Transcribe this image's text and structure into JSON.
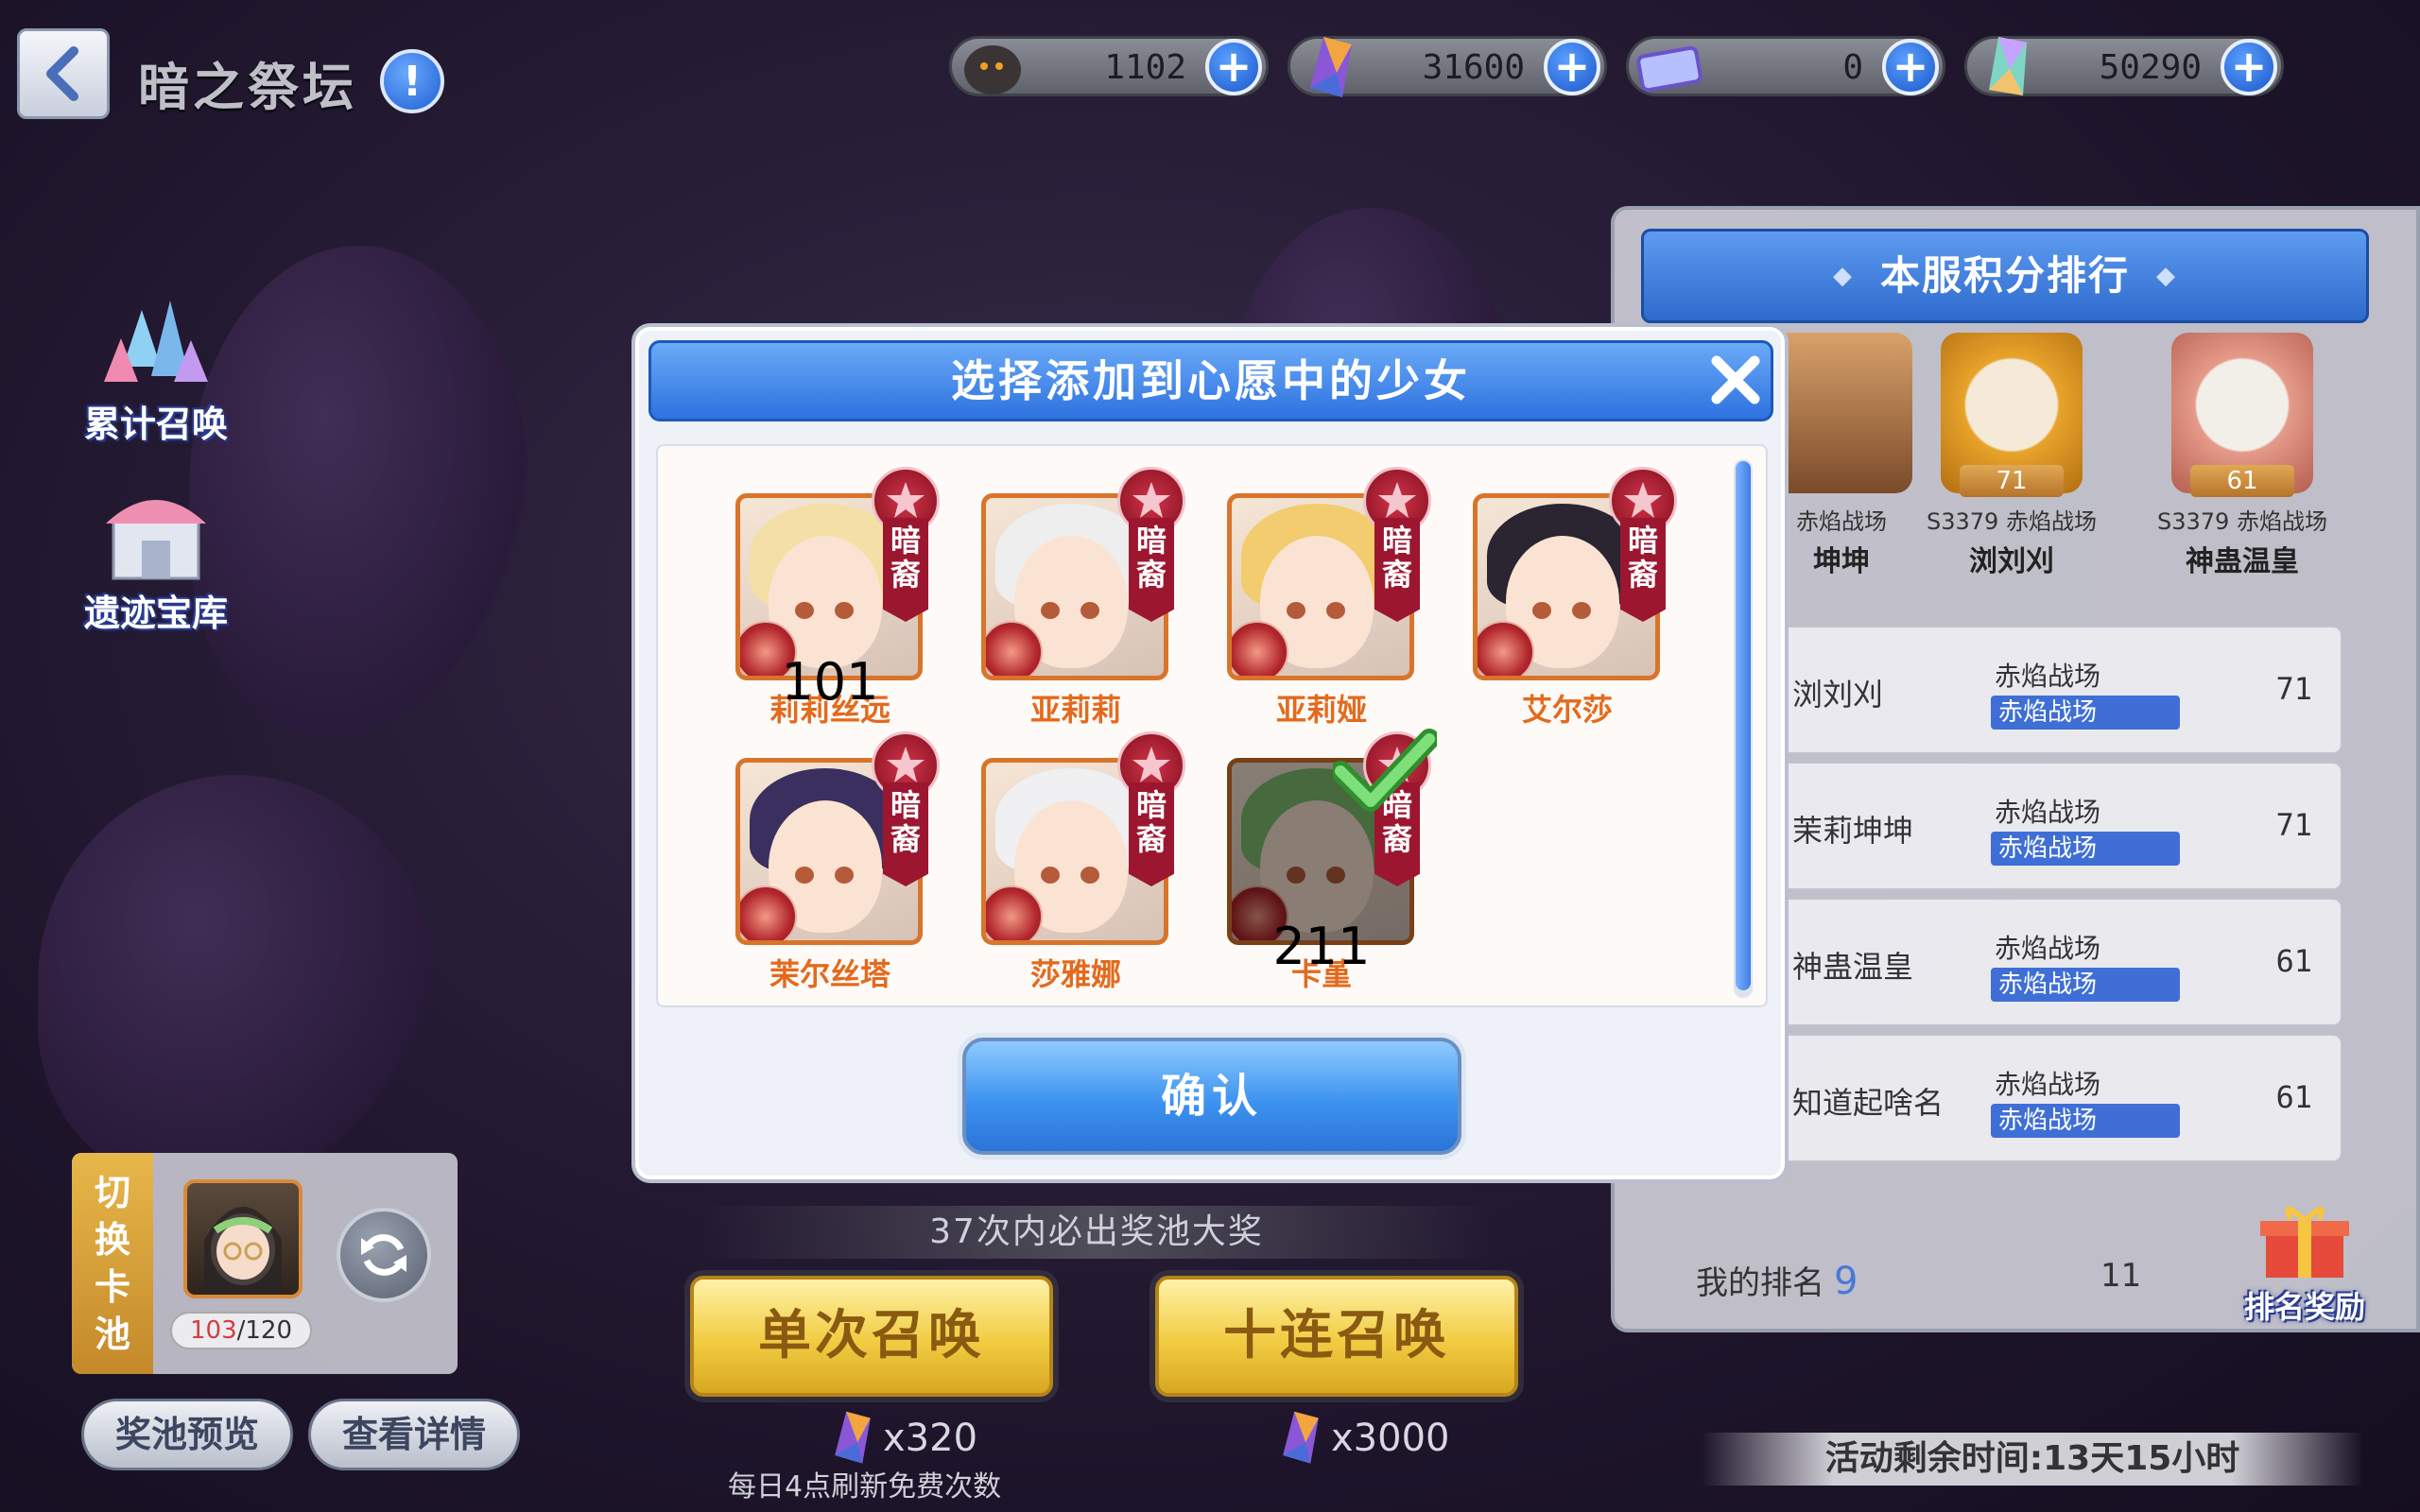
{
  "header": {
    "title": "暗之祭坛",
    "info_label": "!"
  },
  "currencies": [
    {
      "icon": "ghost-token-icon",
      "value": "1102"
    },
    {
      "icon": "crystal-icon",
      "value": "31600"
    },
    {
      "icon": "ticket-icon",
      "value": "0"
    },
    {
      "icon": "rainbow-gem-icon",
      "value": "50290"
    }
  ],
  "plus_label": "+",
  "side_menu": {
    "cumulative_summon": "累计召唤",
    "relic_vault": "遗迹宝库"
  },
  "switch_pool": {
    "label_chars": [
      "切",
      "换",
      "卡",
      "池"
    ],
    "count_current": "103",
    "count_total": "/120"
  },
  "bottom": {
    "pool_preview": "奖池预览",
    "view_details": "查看详情",
    "guarantee_text": "37次内必出奖池大奖",
    "single_summon": "单次召唤",
    "ten_summon": "十连召唤",
    "single_cost": "x320",
    "ten_cost": "x3000",
    "free_note": "每日4点刷新免费次数",
    "time_left": "活动剩余时间:13天15小时"
  },
  "ranking": {
    "title": "本服积分排行",
    "podium": [
      {
        "server": "赤焰战场",
        "name": "坤坤",
        "level": ""
      },
      {
        "server": "S3379 赤焰战场",
        "name": "浏刘刈",
        "level": "71"
      },
      {
        "server": "S3379 赤焰战场",
        "name": "神蛊温皇",
        "level": "61"
      }
    ],
    "rows": [
      {
        "name": "浏刘刈",
        "server": "赤焰战场",
        "tag": "赤焰战场",
        "score": "71"
      },
      {
        "name": "茉莉坤坤",
        "server": "赤焰战场",
        "tag": "赤焰战场",
        "score": "71"
      },
      {
        "name": "神蛊温皇",
        "server": "赤焰战场",
        "tag": "赤焰战场",
        "score": "61"
      },
      {
        "name": "知道起啥名",
        "server": "赤焰战场",
        "tag": "赤焰战场",
        "score": "61"
      }
    ],
    "my_rank_label": "我的排名",
    "my_rank_value": "9",
    "my_score": "11",
    "reward_label": "排名奖励"
  },
  "modal": {
    "title": "选择添加到心愿中的少女",
    "confirm": "确认",
    "faction_badge": "暗裔",
    "cards": [
      {
        "name": "莉莉丝远",
        "overlay": "101",
        "hair": "#f4dfa6",
        "selected": false
      },
      {
        "name": "亚莉莉",
        "overlay": "",
        "hair": "#eeeeee",
        "selected": false
      },
      {
        "name": "亚莉娅",
        "overlay": "",
        "hair": "#f2cc6e",
        "selected": false
      },
      {
        "name": "艾尔莎",
        "overlay": "",
        "hair": "#2a2530",
        "selected": false
      },
      {
        "name": "茉尔丝塔",
        "overlay": "",
        "hair": "#3a2f5e",
        "selected": false
      },
      {
        "name": "莎雅娜",
        "overlay": "",
        "hair": "#f0f0f2",
        "selected": false
      },
      {
        "name": "卡堇",
        "overlay": "211",
        "hair": "#7fbf6e",
        "selected": true
      }
    ]
  }
}
